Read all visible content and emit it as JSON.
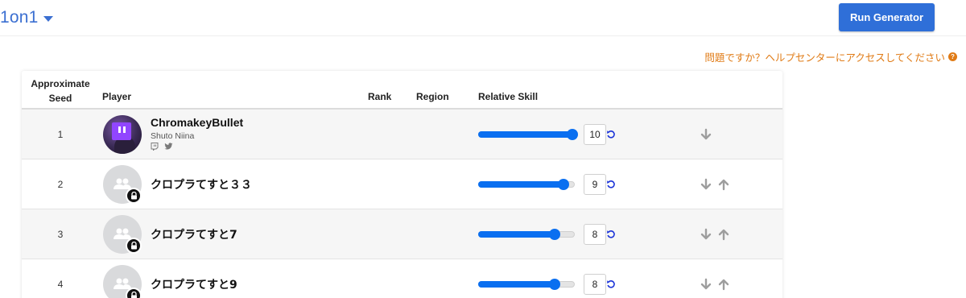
{
  "header": {
    "format_label": "1on1",
    "run_button_label": "Run Generator"
  },
  "help": {
    "text": "問題ですか？ヘルプセンターにアクセスしてください",
    "icon": "question-circle-icon"
  },
  "table": {
    "columns": {
      "seed": "Approximate\nSeed",
      "player": "Player",
      "rank": "Rank",
      "region": "Region",
      "skill": "Relative Skill"
    },
    "rows": [
      {
        "seed": "1",
        "name": "ChromakeyBullet",
        "subname": "Shuto Niina",
        "avatar": "twitch-avatar",
        "skill": "10",
        "skill_level": 1.0,
        "down": true,
        "up": false
      },
      {
        "seed": "2",
        "name": "クロプラてすと３３",
        "subname": "",
        "avatar": "placeholder-avatar",
        "skill": "9",
        "skill_level": 0.9,
        "down": true,
        "up": true
      },
      {
        "seed": "3",
        "name": "クロプラてすと7",
        "subname": "",
        "avatar": "placeholder-avatar",
        "skill": "8",
        "skill_level": 0.8,
        "down": true,
        "up": true
      },
      {
        "seed": "4",
        "name": "クロプラてすと9",
        "subname": "",
        "avatar": "placeholder-avatar",
        "skill": "8",
        "skill_level": 0.8,
        "down": true,
        "up": true
      }
    ]
  },
  "colors": {
    "accent": "#2f6fd8",
    "slider": "#0a6ff0",
    "help": "#e07b16",
    "arrow": "#9e9e9e"
  }
}
